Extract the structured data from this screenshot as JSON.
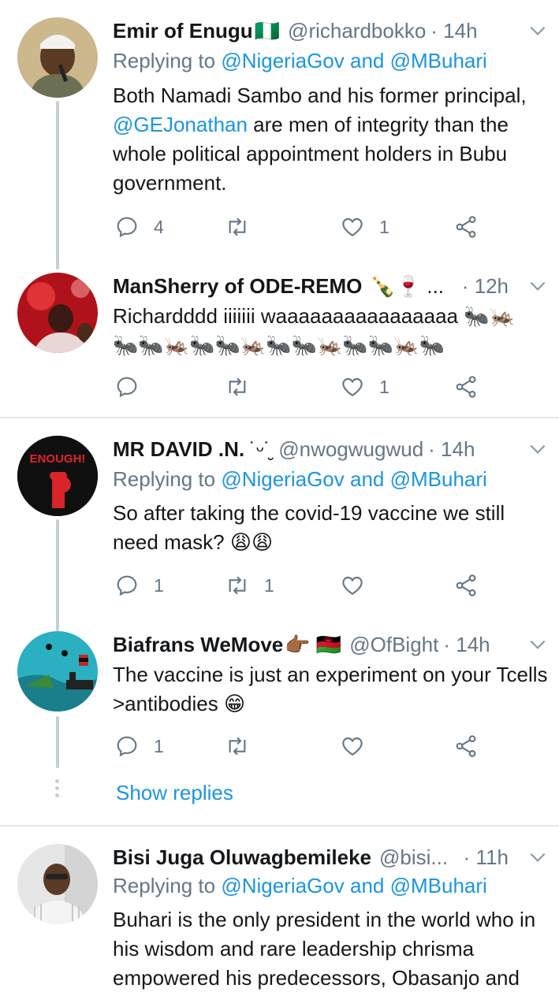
{
  "tweets": [
    {
      "name": "Emir of Enugu",
      "name_emoji": "🇳🇬",
      "handle": "@richardbokko",
      "time": "· 14h",
      "replying_prefix": "Replying to ",
      "replying_to": "@NigeriaGov and @MBuhari",
      "text_1": "Both Namadi Sambo and his former principal, ",
      "mention": "@GEJonathan",
      "text_2": " are men of integrity than the whole political appointment holders in Bubu government.",
      "replies": "4",
      "retweets": "",
      "likes": "1"
    },
    {
      "name": "ManSherry of ODE-REMO",
      "name_emoji": "🍾🍷 ...",
      "time": "· 12h",
      "text": "Richardddd iiiiiii waaaaaaaaaaaaaaaa",
      "replies": "",
      "retweets": "",
      "likes": "1"
    },
    {
      "name": "MR DAVID .N.",
      "name_emoji": "˙ᵕ˙̮",
      "handle": "@nwogwugwud",
      "time": "· 14h",
      "replying_prefix": "Replying to ",
      "replying_to": "@NigeriaGov and @MBuhari",
      "text": "So after taking the covid-19 vaccine we still need mask? 😩😩",
      "replies": "1",
      "retweets": "1",
      "likes": "",
      "avatar_text": "ENOUGH!"
    },
    {
      "name": "Biafrans WeMove",
      "name_emoji": "👉🏾 🇲🇼",
      "handle": "@OfBight",
      "time": "· 14h",
      "text": "The vaccine is just an experiment on your Tcells >antibodies 😁",
      "replies": "1",
      "retweets": "",
      "likes": ""
    },
    {
      "name": "Bisi Juga Oluwagbemileke",
      "handle": "@bisi...",
      "time": "· 11h",
      "replying_prefix": "Replying to ",
      "replying_to": "@NigeriaGov and @MBuhari",
      "text": "Buhari is the only president in the world who in his wisdom and rare leadership chrisma empowered his predecessors, Obasanjo and"
    }
  ],
  "show_replies": "Show replies",
  "colors": {
    "link": "#1b95e0",
    "secondary": "#657786",
    "thread_line": "#c4cfd6",
    "divider": "#e1e8ed"
  }
}
